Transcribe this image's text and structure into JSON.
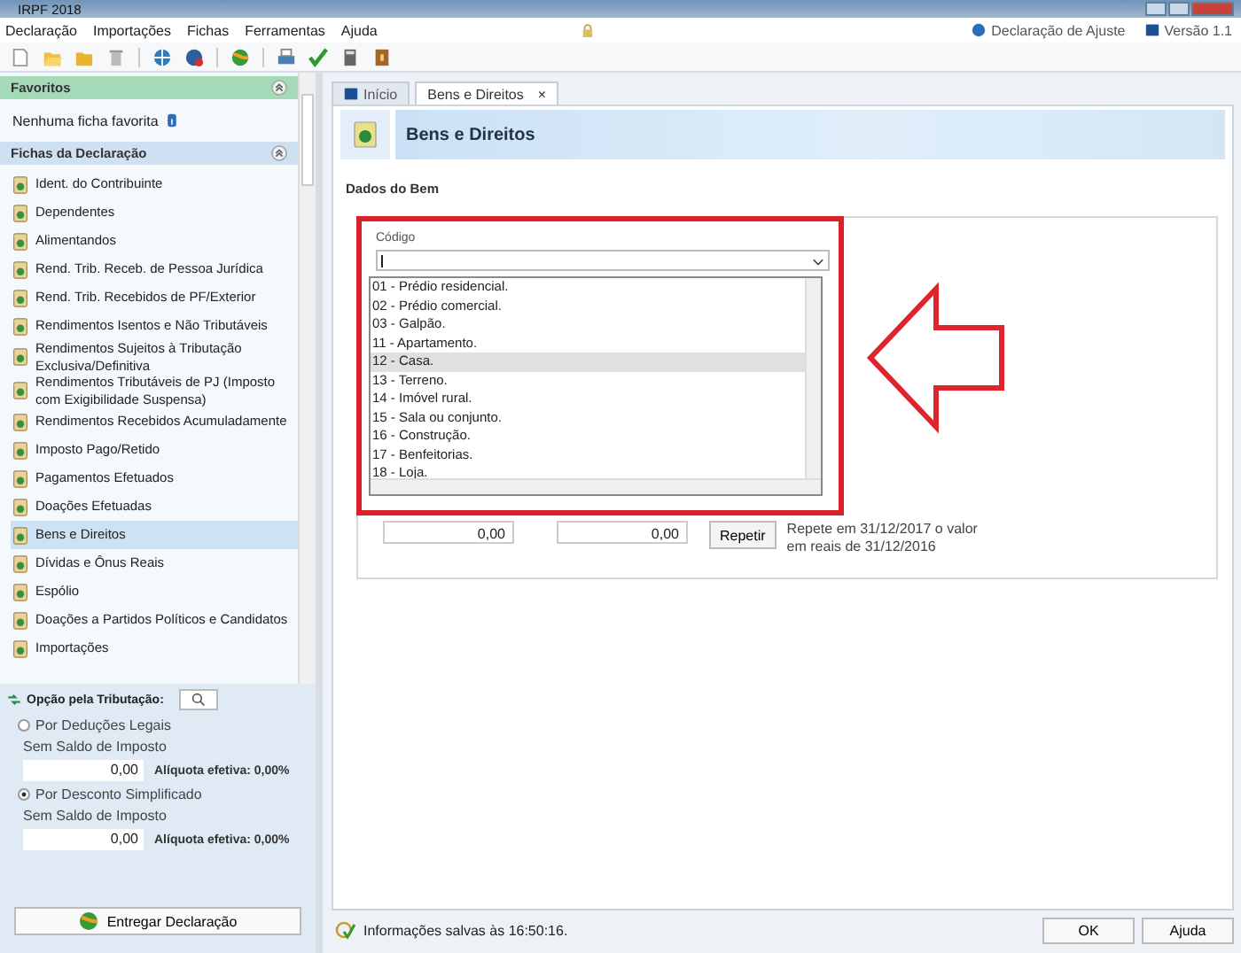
{
  "window": {
    "title": "IRPF 2018"
  },
  "menu": [
    "Declaração",
    "Importações",
    "Fichas",
    "Ferramentas",
    "Ajuda"
  ],
  "menu_right": {
    "declaration_type": "Declaração de Ajuste",
    "version": "Versão 1.1"
  },
  "sidebar": {
    "favorites": {
      "title": "Favoritos",
      "empty_text": "Nenhuma ficha favorita"
    },
    "forms": {
      "title": "Fichas da Declaração",
      "items": [
        {
          "label": "Ident. do Contribuinte",
          "selected": false
        },
        {
          "label": "Dependentes",
          "selected": false
        },
        {
          "label": "Alimentandos",
          "selected": false
        },
        {
          "label": "Rend. Trib. Receb. de Pessoa Jurídica",
          "selected": false
        },
        {
          "label": "Rend. Trib. Recebidos de PF/Exterior",
          "selected": false
        },
        {
          "label": "Rendimentos Isentos e Não Tributáveis",
          "selected": false
        },
        {
          "label": "Rendimentos Sujeitos à Tributação Exclusiva/Definitiva",
          "selected": false
        },
        {
          "label": "Rendimentos Tributáveis de PJ (Imposto com Exigibilidade Suspensa)",
          "selected": false
        },
        {
          "label": "Rendimentos Recebidos Acumuladamente",
          "selected": false
        },
        {
          "label": "Imposto Pago/Retido",
          "selected": false
        },
        {
          "label": "Pagamentos Efetuados",
          "selected": false
        },
        {
          "label": "Doações Efetuadas",
          "selected": false
        },
        {
          "label": "Bens e Direitos",
          "selected": true
        },
        {
          "label": "Dívidas e Ônus Reais",
          "selected": false
        },
        {
          "label": "Espólio",
          "selected": false
        },
        {
          "label": "Doações a Partidos Políticos e Candidatos",
          "selected": false
        },
        {
          "label": "Importações",
          "selected": false
        }
      ]
    },
    "taxation": {
      "title": "Opção pela Tributação:",
      "options": [
        {
          "label": "Por Deduções Legais",
          "selected": false,
          "balance_label": "Sem Saldo de Imposto",
          "value": "0,00",
          "rate": "Alíquota efetiva: 0,00%"
        },
        {
          "label": "Por Desconto Simplificado",
          "selected": true,
          "balance_label": "Sem Saldo de Imposto",
          "value": "0,00",
          "rate": "Alíquota efetiva: 0,00%"
        }
      ]
    },
    "submit_button": "Entregar Declaração"
  },
  "tabs": [
    {
      "label": "Início",
      "selected": false
    },
    {
      "label": "Bens e Direitos",
      "selected": true,
      "close": "×"
    }
  ],
  "page": {
    "title": "Bens e Direitos",
    "section": "Dados do Bem",
    "code_field": {
      "label": "Código",
      "options": [
        {
          "label": "01 - Prédio residencial.",
          "selected": false
        },
        {
          "label": "02 - Prédio comercial.",
          "selected": false
        },
        {
          "label": "03 - Galpão.",
          "selected": false
        },
        {
          "label": "11 - Apartamento.",
          "selected": false
        },
        {
          "label": "12 - Casa.",
          "selected": true
        },
        {
          "label": "13 - Terreno.",
          "selected": false
        },
        {
          "label": "14 - Imóvel rural.",
          "selected": false
        },
        {
          "label": "15 - Sala ou conjunto.",
          "selected": false
        },
        {
          "label": "16 - Construção.",
          "selected": false
        },
        {
          "label": "17 - Benfeitorias.",
          "selected": false
        },
        {
          "label": "18 - Loja.",
          "selected": false
        }
      ]
    },
    "values": [
      "0,00",
      "0,00"
    ],
    "repeat_button": "Repetir",
    "repeat_note": "Repete em 31/12/2017 o valor em reais de 31/12/2016"
  },
  "status_bar": {
    "message": "Informações salvas às 16:50:16.",
    "buttons": [
      "OK",
      "Ajuda"
    ]
  }
}
